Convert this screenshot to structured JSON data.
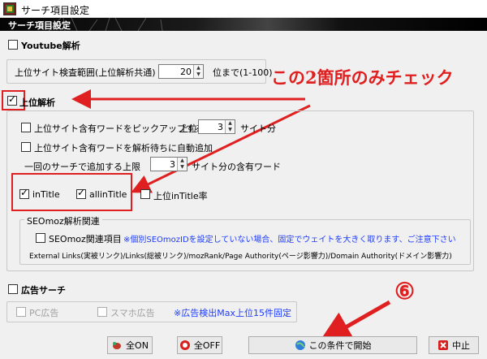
{
  "window": {
    "title": "サーチ項目設定"
  },
  "header": {
    "label": "サーチ項目設定"
  },
  "youtube": {
    "label": "Youtube解析",
    "range_label": "上位サイト検査範囲(上位解析共通)",
    "range_value": "20",
    "range_suffix": "位まで(1-100)"
  },
  "top": {
    "label": "上位解析",
    "pickup_label": "上位サイト含有ワードをピックアップする",
    "pickup_prefix": "上位",
    "pickup_value": "3",
    "pickup_suffix": "サイト分",
    "auto_label": "上位サイト含有ワードを解析待ちに自動追加",
    "limit_label": "一回のサーチで追加する上限",
    "limit_value": "3",
    "limit_suffix": "サイト分の含有ワード",
    "intitle_label": "inTitle",
    "allintitle_label": "allinTitle",
    "rate_label": "上位inTitle率",
    "seo_group": "SEOmoz解析関連",
    "seo_label": "SEOmoz関連項目",
    "seo_note": "※個別SEOmozIDを設定していない場合、固定でウェイトを大きく取ります、ご注意下さい",
    "seo_links": "External Links(実被リンク)/Links(総被リンク)/mozRank/Page Authority(ページ影響力)/Domain Authority(ドメイン影響力)"
  },
  "ad": {
    "label": "広告サーチ",
    "pc_label": "PC広告",
    "sp_label": "スマホ広告",
    "note": "※広告検出Max上位15件固定"
  },
  "buttons": {
    "all_on": "全ON",
    "all_off": "全OFF",
    "start": "この条件で開始",
    "cancel": "中止"
  },
  "annotations": {
    "check_note": "この2箇所のみチェック",
    "step": "⑥"
  },
  "colors": {
    "annotation_red": "#e02020",
    "note_blue": "#1e3cff"
  },
  "state": {
    "youtube": false,
    "top": true,
    "pickup": false,
    "auto": false,
    "intitle": true,
    "allintitle": true,
    "rate": false,
    "seo": false,
    "ad": false,
    "pc": false,
    "sp": false
  }
}
